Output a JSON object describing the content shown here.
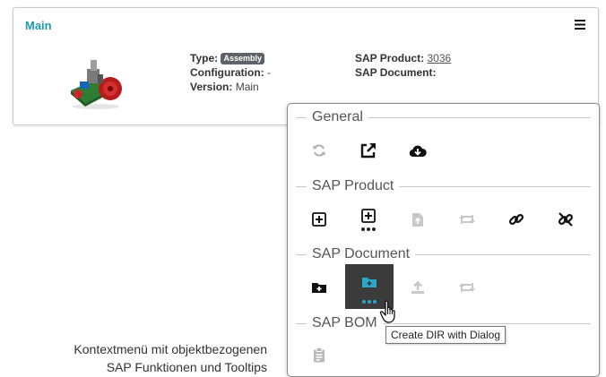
{
  "card": {
    "title": "Main",
    "type_label": "Type:",
    "type_badge": "Assembly",
    "configuration_label": "Configuration:",
    "configuration_value": "-",
    "version_label": "Version:",
    "version_value": "Main",
    "sap_product_label": "SAP Product:",
    "sap_product_value": "3036",
    "sap_document_label": "SAP Document:",
    "menu_icon": "hamburger-icon"
  },
  "context_menu": {
    "sections": [
      {
        "title": "General",
        "icons": [
          "refresh-icon",
          "open-external-icon",
          "cloud-download-icon"
        ]
      },
      {
        "title": "SAP Product",
        "icons": [
          "add-square-icon",
          "add-square-dialog-icon",
          "file-upload-icon",
          "sync-icon",
          "link-icon",
          "unlink-icon"
        ]
      },
      {
        "title": "SAP Document",
        "icons": [
          "folder-plus-icon",
          "folder-plus-dialog-icon",
          "upload-icon",
          "sync-icon"
        ]
      },
      {
        "title": "SAP BOM",
        "icons": [
          "clipboard-icon"
        ]
      }
    ],
    "tooltip": "Create DIR with Dialog",
    "accent_color": "#2aa7c9"
  },
  "caption": {
    "line1": "Kontextmenü mit objektbezogenen",
    "line2": "SAP Funktionen und Tooltips"
  },
  "colors": {
    "title": "#1f9bb0",
    "badge": "#5d6368",
    "active_bg": "#3b3b3b"
  }
}
